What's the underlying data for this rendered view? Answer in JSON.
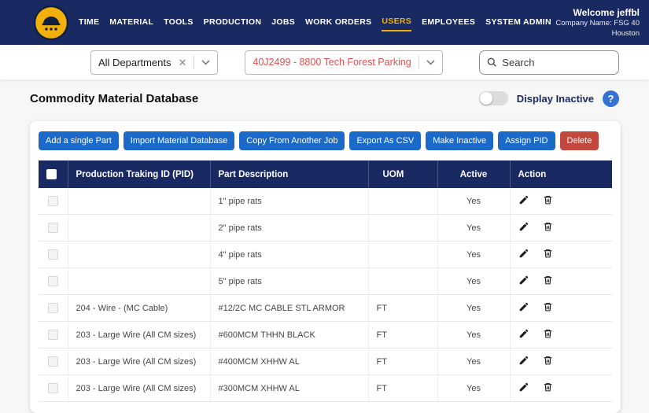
{
  "navbar": {
    "menu": [
      {
        "label": "TIME",
        "active": false
      },
      {
        "label": "MATERIAL",
        "active": false
      },
      {
        "label": "TOOLS",
        "active": false
      },
      {
        "label": "PRODUCTION",
        "active": false
      },
      {
        "label": "JOBS",
        "active": false
      },
      {
        "label": "WORK ORDERS",
        "active": false
      },
      {
        "label": "USERS",
        "active": true
      },
      {
        "label": "EMPLOYEES",
        "active": false
      },
      {
        "label": "SYSTEM ADMIN",
        "active": false
      }
    ],
    "welcome": "Welcome jeffbl",
    "company": "Company Name: FSG 40 Houston"
  },
  "filters": {
    "department": "All Departments",
    "job": "40J2499 - 8800 Tech Forest Parking",
    "search_placeholder": "Search"
  },
  "page": {
    "title": "Commodity Material Database",
    "display_inactive_label": "Display Inactive",
    "help_label": "?"
  },
  "toolbar": {
    "buttons": [
      "Add a single Part",
      "Import Material Database",
      "Copy From Another Job",
      "Export As CSV",
      "Make Inactive",
      "Assign PID",
      "Delete"
    ]
  },
  "table": {
    "headers": [
      "Production Traking ID (PID)",
      "Part Description",
      "UOM",
      "Active",
      "Action"
    ],
    "rows": [
      {
        "pid": "",
        "description": "1\" pipe rats",
        "uom": "",
        "active": "Yes"
      },
      {
        "pid": "",
        "description": "2\" pipe rats",
        "uom": "",
        "active": "Yes"
      },
      {
        "pid": "",
        "description": "4\" pipe rats",
        "uom": "",
        "active": "Yes"
      },
      {
        "pid": "",
        "description": "5\" pipe rats",
        "uom": "",
        "active": "Yes"
      },
      {
        "pid": "204 - Wire - (MC Cable)",
        "description": "#12/2C MC CABLE STL ARMOR",
        "uom": "FT",
        "active": "Yes"
      },
      {
        "pid": "203 - Large Wire (All CM sizes)",
        "description": "#600MCM THHN BLACK",
        "uom": "FT",
        "active": "Yes"
      },
      {
        "pid": "203 - Large Wire (All CM sizes)",
        "description": "#400MCM XHHW AL",
        "uom": "FT",
        "active": "Yes"
      },
      {
        "pid": "203 - Large Wire (All CM sizes)",
        "description": "#300MCM XHHW AL",
        "uom": "FT",
        "active": "Yes"
      }
    ]
  },
  "colors": {
    "navy": "#192a63",
    "accent_yellow": "#f2b100",
    "button_blue": "#1b6ac9",
    "delete_red": "#c2473d",
    "job_text_red": "#e05050",
    "help_blue": "#3572d3"
  }
}
